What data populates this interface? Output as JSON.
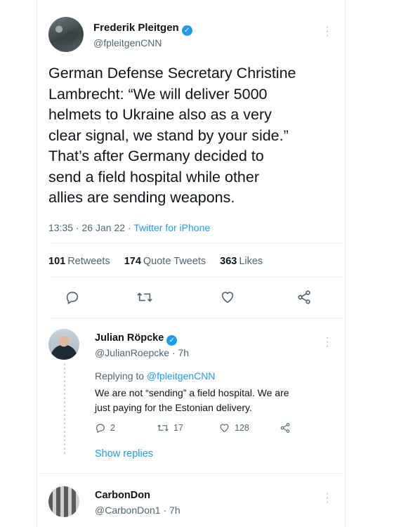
{
  "main_tweet": {
    "author_name": "Frederik Pleitgen",
    "author_handle": "@fpleitgenCNN",
    "verified_mark": "✓",
    "text_lines": [
      "German Defense Secretary Christine",
      "Lambrecht: “We will deliver 5000",
      "helmets to Ukraine also as a very",
      "clear signal, we stand by your side.”",
      "That’s after Germany decided to",
      "send a field hospital while other",
      "allies are sending weapons."
    ],
    "time": "13:35",
    "date": "26 Jan 22",
    "source": "Twitter for iPhone",
    "stats": {
      "retweets_count": "101",
      "retweets_label": "Retweets",
      "quote_count": "174",
      "quote_label": "Quote Tweets",
      "likes_count": "363",
      "likes_label": "Likes"
    }
  },
  "reply_1": {
    "author_name": "Julian Röpcke",
    "author_handle": "@JulianRoepcke",
    "time": "7h",
    "replying_prefix": "Replying to",
    "replying_handle": "@fpleitgenCNN",
    "text_lines": [
      "We are not “sending” a field hospital. We are",
      "just paying for the Estonian delivery."
    ],
    "reply_count": "2",
    "retweet_count": "17",
    "like_count": "128",
    "show_replies": "Show replies"
  },
  "reply_2": {
    "author_name": "CarbonDon",
    "author_handle": "@CarbonDon1",
    "time": "7h"
  },
  "separator": "·",
  "colors": {
    "accent": "#1d9bf0",
    "text": "#0f1419",
    "secondary": "#536471"
  }
}
